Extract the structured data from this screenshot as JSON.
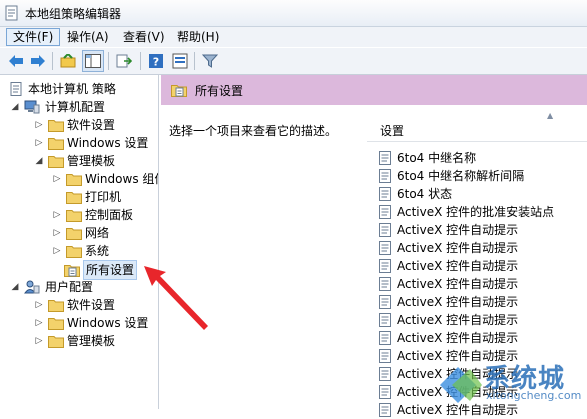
{
  "window": {
    "title": "本地组策略编辑器"
  },
  "menu": [
    {
      "label": "文件(F)"
    },
    {
      "label": "操作(A)"
    },
    {
      "label": "查看(V)"
    },
    {
      "label": "帮助(H)"
    }
  ],
  "toolbar": {
    "icons": [
      "back-icon",
      "forward-icon",
      "up-folder-icon",
      "show-hide-tree-icon",
      "export-list-icon",
      "help-icon",
      "properties-icon",
      "filter-icon"
    ]
  },
  "tree": {
    "items": [
      {
        "label": "本地计算机 策略"
      },
      {
        "label": "计算机配置"
      },
      {
        "label": "软件设置"
      },
      {
        "label": "Windows 设置"
      },
      {
        "label": "管理模板"
      },
      {
        "label": "Windows 组件"
      },
      {
        "label": "打印机"
      },
      {
        "label": "控制面板"
      },
      {
        "label": "网络"
      },
      {
        "label": "系统"
      },
      {
        "label": "所有设置"
      },
      {
        "label": "用户配置"
      },
      {
        "label": "软件设置"
      },
      {
        "label": "Windows 设置"
      },
      {
        "label": "管理模板"
      }
    ]
  },
  "panel": {
    "title": "所有设置",
    "description": "选择一个项目来查看它的描述。",
    "column_header": "设置",
    "items": [
      "6to4 中继名称",
      "6to4 中继名称解析间隔",
      "6to4 状态",
      "ActiveX 控件的批准安装站点",
      "ActiveX 控件自动提示",
      "ActiveX 控件自动提示",
      "ActiveX 控件自动提示",
      "ActiveX 控件自动提示",
      "ActiveX 控件自动提示",
      "ActiveX 控件自动提示",
      "ActiveX 控件自动提示",
      "ActiveX 控件自动提示",
      "ActiveX 控件自动提示",
      "ActiveX 控件自动提示",
      "ActiveX 控件自动提示"
    ]
  },
  "watermark": {
    "text": "系统城",
    "sub": "xitongcheng.com"
  },
  "colors": {
    "header_band": "#dcb8dc",
    "arrow": "#e8262b",
    "selection": "#dbe9f8"
  }
}
